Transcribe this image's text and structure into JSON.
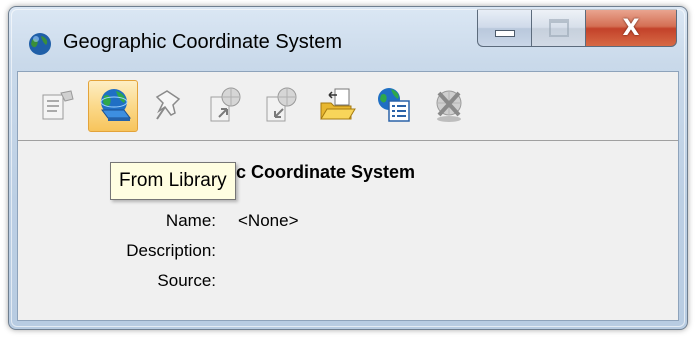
{
  "window": {
    "title": "Geographic Coordinate System",
    "close_glyph": "X"
  },
  "toolbar": {
    "buttons": [
      {
        "name": "properties",
        "icon": "properties-icon",
        "state": "disabled"
      },
      {
        "name": "from-library",
        "icon": "globe-library-icon",
        "state": "hover"
      },
      {
        "name": "pick",
        "icon": "pushpin-icon",
        "state": "disabled"
      },
      {
        "name": "export",
        "icon": "globe-export-icon",
        "state": "disabled"
      },
      {
        "name": "import",
        "icon": "globe-import-icon",
        "state": "disabled"
      },
      {
        "name": "open-file",
        "icon": "open-folder-icon",
        "state": "enabled"
      },
      {
        "name": "reports",
        "icon": "globe-list-icon",
        "state": "enabled"
      },
      {
        "name": "delete",
        "icon": "globe-delete-icon",
        "state": "disabled"
      }
    ],
    "tooltip": "From Library"
  },
  "content": {
    "heading": "Geographic Coordinate System",
    "fields": [
      {
        "label": "Name:",
        "value": "<None>"
      },
      {
        "label": "Description:",
        "value": ""
      },
      {
        "label": "Source:",
        "value": ""
      }
    ]
  },
  "colors": {
    "accent_hover": "#f7c45c",
    "close_button": "#c3422a",
    "tooltip_bg": "#fffee1"
  }
}
